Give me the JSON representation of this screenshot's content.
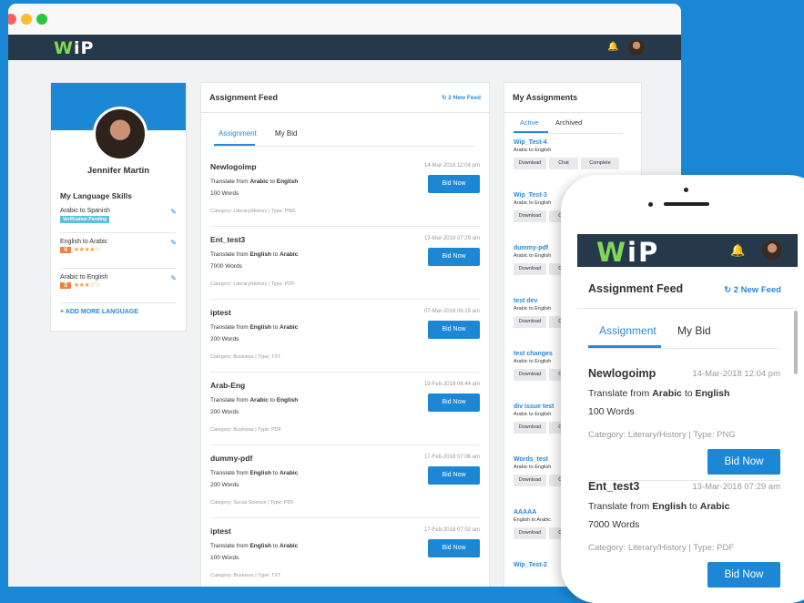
{
  "brand": {
    "logo_w": "W",
    "logo_ip": "iP",
    "green": "#7ed957",
    "navy": "#26394a",
    "accent": "#1b87d5"
  },
  "window_dots": [
    "#ff5f57",
    "#febc2e",
    "#28c840"
  ],
  "header": {
    "bell_icon": "bell-icon",
    "avatar": "user-avatar"
  },
  "profile": {
    "name": "Jennifer Martin",
    "skills_heading": "My Language Skills",
    "skills": [
      {
        "label": "Arabic to Spanish",
        "badge": "Verification Pending",
        "stars": ""
      },
      {
        "label": "English to Arabic",
        "level": "4",
        "stars": "★★★★☆"
      },
      {
        "label": "Arabic to English",
        "level": "3",
        "stars": "★★★☆☆"
      }
    ],
    "add_more": "+ ADD MORE LANGUAGE"
  },
  "feed": {
    "title": "Assignment Feed",
    "new_feed": "2 New Feed",
    "tabs": [
      "Assignment",
      "My Bid"
    ],
    "bid_label": "Bid Now",
    "items": [
      {
        "title": "Newlogoimp",
        "date": "14-Mar-2018 12:04 pm",
        "from": "Arabic",
        "to": "English",
        "words": "100 Words",
        "category": "Category: Literary/History | Type: PNG"
      },
      {
        "title": "Ent_test3",
        "date": "13-Mar-2018 07:29 am",
        "from": "English",
        "to": "Arabic",
        "words": "7000 Words",
        "category": "Category: Literary/History | Type: PDF"
      },
      {
        "title": "iptest",
        "date": "07-Mar-2018 08:19 am",
        "from": "English",
        "to": "Arabic",
        "words": "200 Words",
        "category": "Category: Business | Type: TXT"
      },
      {
        "title": "Arab-Eng",
        "date": "19-Feb-2018 06:44 am",
        "from": "Arabic",
        "to": "English",
        "words": "200 Words",
        "category": "Category: Business | Type: PDF"
      },
      {
        "title": "dummy-pdf",
        "date": "17-Feb-2018 07:06 am",
        "from": "English",
        "to": "Arabic",
        "words": "200 Words",
        "category": "Category: Social Science | Type: PDF"
      },
      {
        "title": "iptest",
        "date": "17-Feb-2018 07:02 am",
        "from": "English",
        "to": "Arabic",
        "words": "100 Words",
        "category": "Category: Business | Type: TXT"
      }
    ],
    "translate_prefix": "Translate from",
    "translate_mid": "to"
  },
  "my_assignments": {
    "title": "My Assignments",
    "tabs": [
      "Active",
      "Archived"
    ],
    "buttons": [
      "Download",
      "Chat",
      "Complete"
    ],
    "items": [
      {
        "title": "Wip_Test-4",
        "sub": "Arabic to English"
      },
      {
        "title": "Wip_Test-3",
        "sub": "Arabic to English"
      },
      {
        "title": "dummy-pdf",
        "sub": "Arabic to English"
      },
      {
        "title": "test dev",
        "sub": "Arabic to English"
      },
      {
        "title": "test changes",
        "sub": "Arabic to English"
      },
      {
        "title": "div issue test",
        "sub": "Arabic to English"
      },
      {
        "title": "Words_test",
        "sub": "Arabic to English"
      },
      {
        "title": "AAAAA",
        "sub": "English to Arabic"
      },
      {
        "title": "Wip_Test-2",
        "sub": ""
      }
    ]
  },
  "phone": {
    "feed_title": "Assignment Feed",
    "new_feed": "2 New Feed",
    "tabs": [
      "Assignment",
      "My Bid"
    ],
    "bid_label": "Bid Now",
    "items": [
      {
        "title": "Newlogoimp",
        "date": "14-Mar-2018 12:04 pm",
        "from": "Arabic",
        "to": "English",
        "words": "100 Words",
        "category": "Category: Literary/History | Type: PNG"
      },
      {
        "title": "Ent_test3",
        "date": "13-Mar-2018 07:29 am",
        "from": "English",
        "to": "Arabic",
        "words": "7000 Words",
        "category": "Category: Literary/History | Type: PDF"
      }
    ]
  }
}
